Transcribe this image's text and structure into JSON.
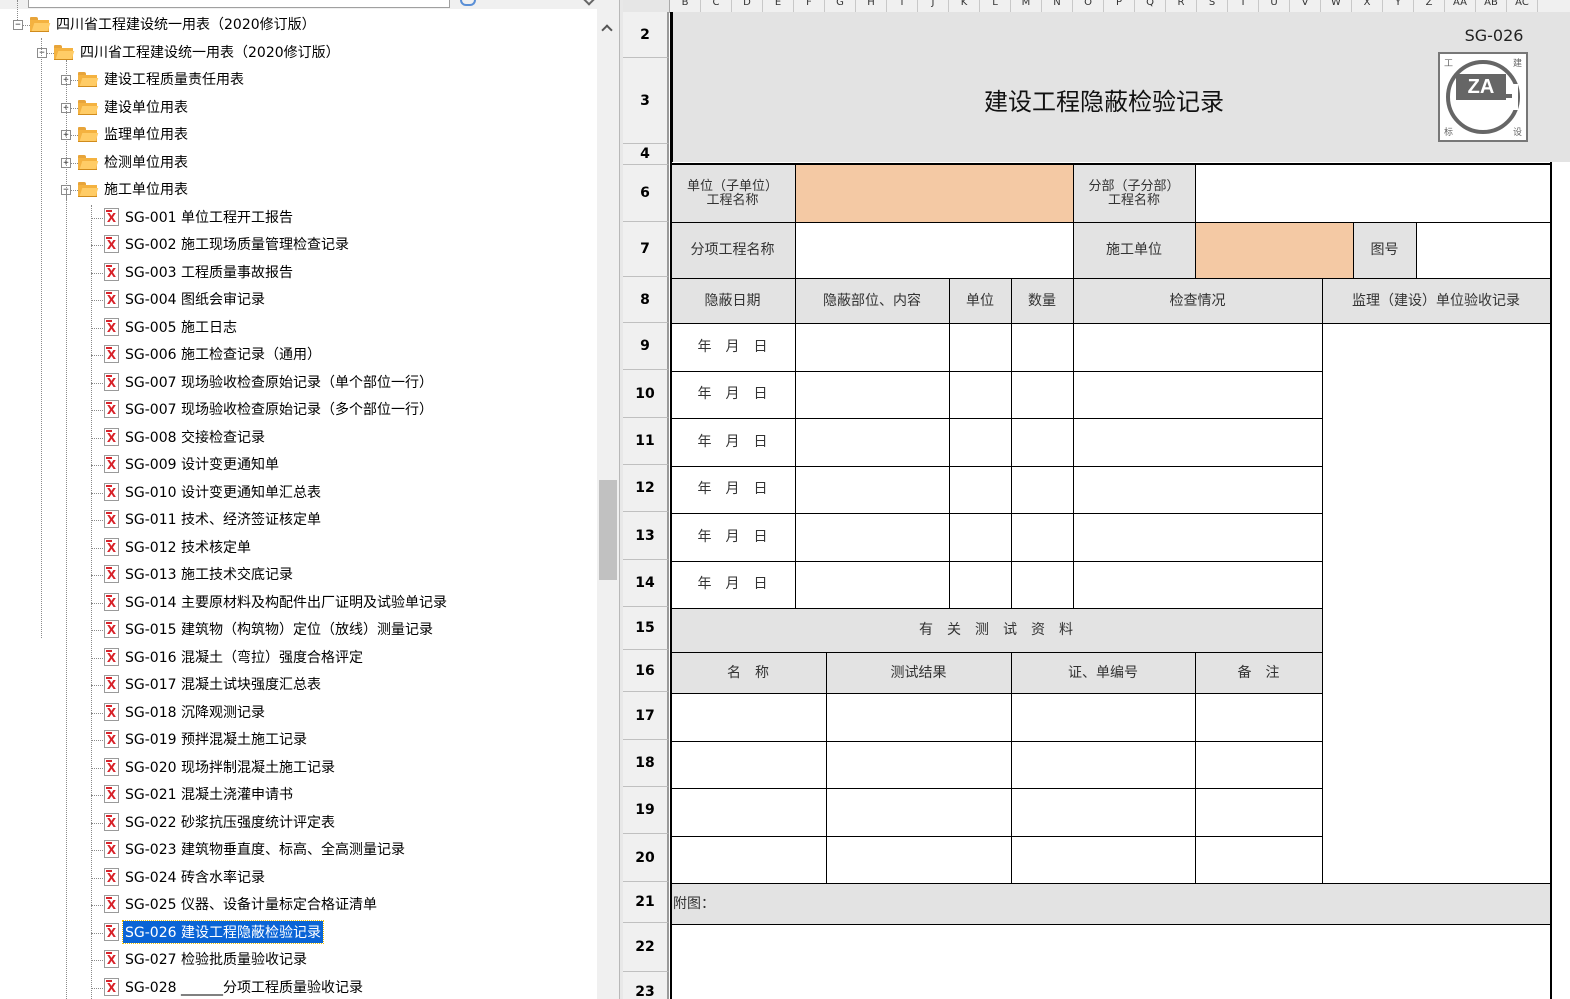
{
  "tree": {
    "nodes": [
      {
        "label": "四川省工程建设统一用表（2020修订版）",
        "type": "folder"
      },
      {
        "label": "四川省工程建设统一用表（2020修订版）",
        "type": "folder"
      },
      {
        "label": "建设工程质量责任用表",
        "type": "folder"
      },
      {
        "label": "建设单位用表",
        "type": "folder"
      },
      {
        "label": "监理单位用表",
        "type": "folder"
      },
      {
        "label": "检测单位用表",
        "type": "folder"
      },
      {
        "label": "施工单位用表",
        "type": "folder"
      },
      {
        "label": "SG-001 单位工程开工报告",
        "type": "doc"
      },
      {
        "label": "SG-002 施工现场质量管理检查记录",
        "type": "doc"
      },
      {
        "label": "SG-003 工程质量事故报告",
        "type": "doc"
      },
      {
        "label": "SG-004 图纸会审记录",
        "type": "doc"
      },
      {
        "label": "SG-005 施工日志",
        "type": "doc"
      },
      {
        "label": "SG-006 施工检查记录（通用）",
        "type": "doc"
      },
      {
        "label": "SG-007 现场验收检查原始记录（单个部位一行）",
        "type": "doc"
      },
      {
        "label": "SG-007 现场验收检查原始记录（多个部位一行）",
        "type": "doc"
      },
      {
        "label": "SG-008 交接检查记录",
        "type": "doc"
      },
      {
        "label": "SG-009 设计变更通知单",
        "type": "doc"
      },
      {
        "label": "SG-010 设计变更通知单汇总表",
        "type": "doc"
      },
      {
        "label": "SG-011 技术、经济签证核定单",
        "type": "doc"
      },
      {
        "label": "SG-012 技术核定单",
        "type": "doc"
      },
      {
        "label": "SG-013 施工技术交底记录",
        "type": "doc"
      },
      {
        "label": "SG-014 主要原材料及构配件出厂证明及试验单记录",
        "type": "doc"
      },
      {
        "label": "SG-015 建筑物（构筑物）定位（放线）测量记录",
        "type": "doc"
      },
      {
        "label": "SG-016 混凝土（弯拉）强度合格评定",
        "type": "doc"
      },
      {
        "label": "SG-017 混凝土试块强度汇总表",
        "type": "doc"
      },
      {
        "label": "SG-018 沉降观测记录",
        "type": "doc"
      },
      {
        "label": "SG-019 预拌混凝土施工记录",
        "type": "doc"
      },
      {
        "label": "SG-020 现场拌制混凝土施工记录",
        "type": "doc"
      },
      {
        "label": "SG-021 混凝土浇灌申请书",
        "type": "doc"
      },
      {
        "label": "SG-022 砂浆抗压强度统计评定表",
        "type": "doc"
      },
      {
        "label": "SG-023 建筑物垂直度、标高、全高测量记录",
        "type": "doc"
      },
      {
        "label": "SG-024 砖含水率记录",
        "type": "doc"
      },
      {
        "label": "SG-025 仪器、设备计量标定合格证清单",
        "type": "doc"
      },
      {
        "label": "SG-026 建设工程隐蔽检验记录",
        "type": "doc",
        "selected": true
      },
      {
        "label": "SG-027 检验批质量验收记录",
        "type": "doc"
      },
      {
        "label": "SG-028 ______分项工程质量验收记录",
        "type": "doc"
      }
    ]
  },
  "sheet": {
    "columns": [
      "B",
      "C",
      "D",
      "E",
      "F",
      "G",
      "H",
      "I",
      "J",
      "K",
      "L",
      "M",
      "N",
      "O",
      "P",
      "Q",
      "R",
      "S",
      "T",
      "U",
      "V",
      "W",
      "X",
      "Y",
      "Z",
      "AA",
      "AB",
      "AC"
    ],
    "rows": [
      "2",
      "3",
      "4",
      "6",
      "7",
      "8",
      "9",
      "10",
      "11",
      "12",
      "13",
      "14",
      "15",
      "16",
      "17",
      "18",
      "19",
      "20",
      "21",
      "22",
      "23"
    ],
    "code": "SG-026",
    "title": "建设工程隐蔽检验记录",
    "logo": {
      "main": "ZA",
      "c1": "工",
      "c2": "建",
      "c3": "标",
      "c4": "设"
    },
    "labels": {
      "unit_project": "单位（子单位）\n工程名称",
      "sub_project": "分部（子分部）\n工程名称",
      "item_project": "分项工程名称",
      "contractor": "施工单位",
      "drawing_no": "图号",
      "hidden_date": "隐蔽日期",
      "hidden_part": "隐蔽部位、内容",
      "unit": "单位",
      "quantity": "数量",
      "inspection": "检查情况",
      "supervision": "监理（建设）单位验收记录",
      "date_placeholder": "年　月　日",
      "test_section": "有　关　测　试　资　料",
      "name": "名　称",
      "test_result": "测试结果",
      "cert_no": "证、单编号",
      "remark": "备　注",
      "attachment": "附图："
    },
    "colors": {
      "shaded": "#e3e3e3",
      "input": "#f4c9a4",
      "selection": "#0a64d6"
    }
  }
}
